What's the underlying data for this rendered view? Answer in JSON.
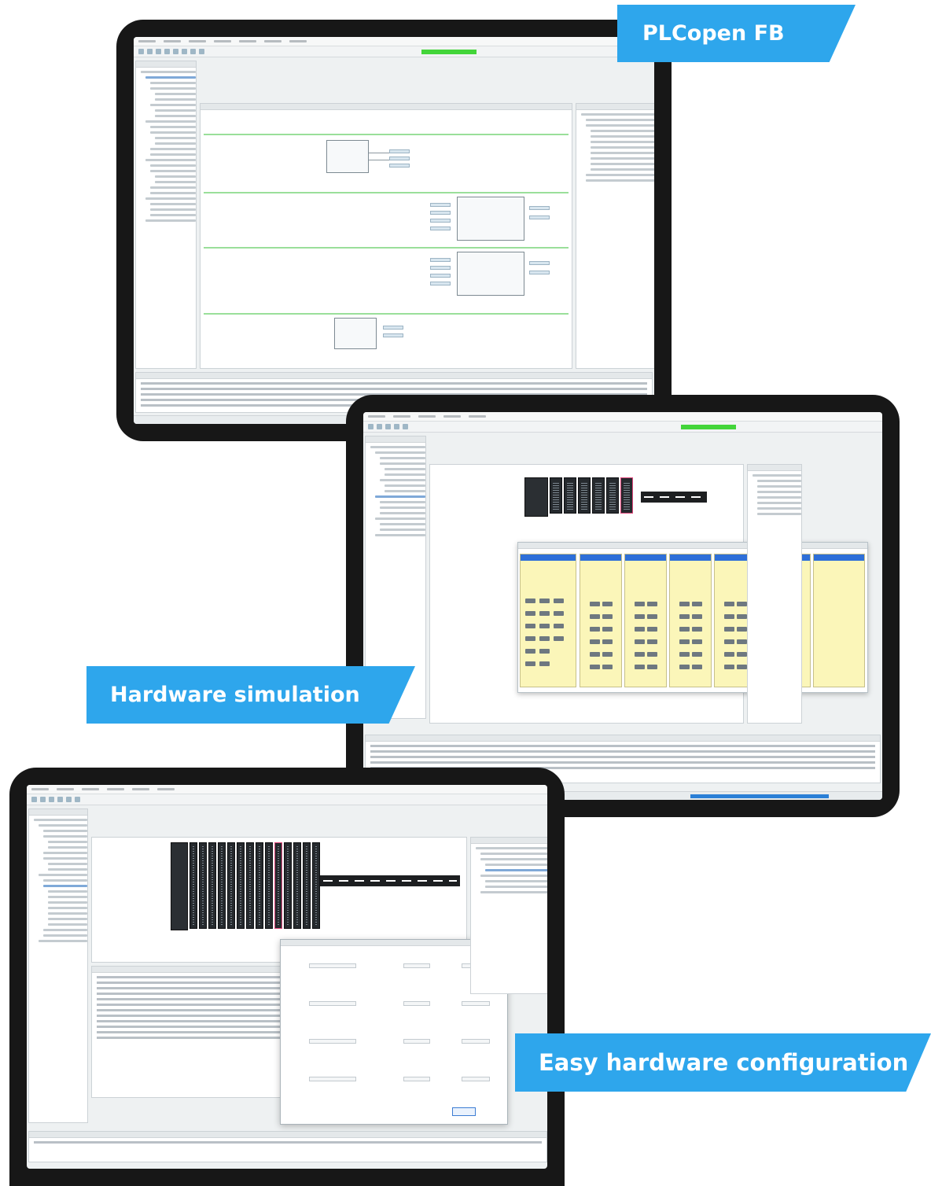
{
  "banners": {
    "plcopen": "PLCopen FB",
    "hardware_simulation": "Hardware simulation",
    "hardware_configuration": "Easy hardware configuration"
  },
  "colors": {
    "banner_blue": "#2ea6ec",
    "tablet_frame": "#171717",
    "run_indicator_green": "#43d53a",
    "simulation_panel_yellow": "#fbf6b9",
    "selection_pink": "#e0467b"
  },
  "icons": [
    "menu-icon",
    "toolbar-icon",
    "folder-tree-icon",
    "io-module-icon",
    "cpu-module-icon"
  ]
}
